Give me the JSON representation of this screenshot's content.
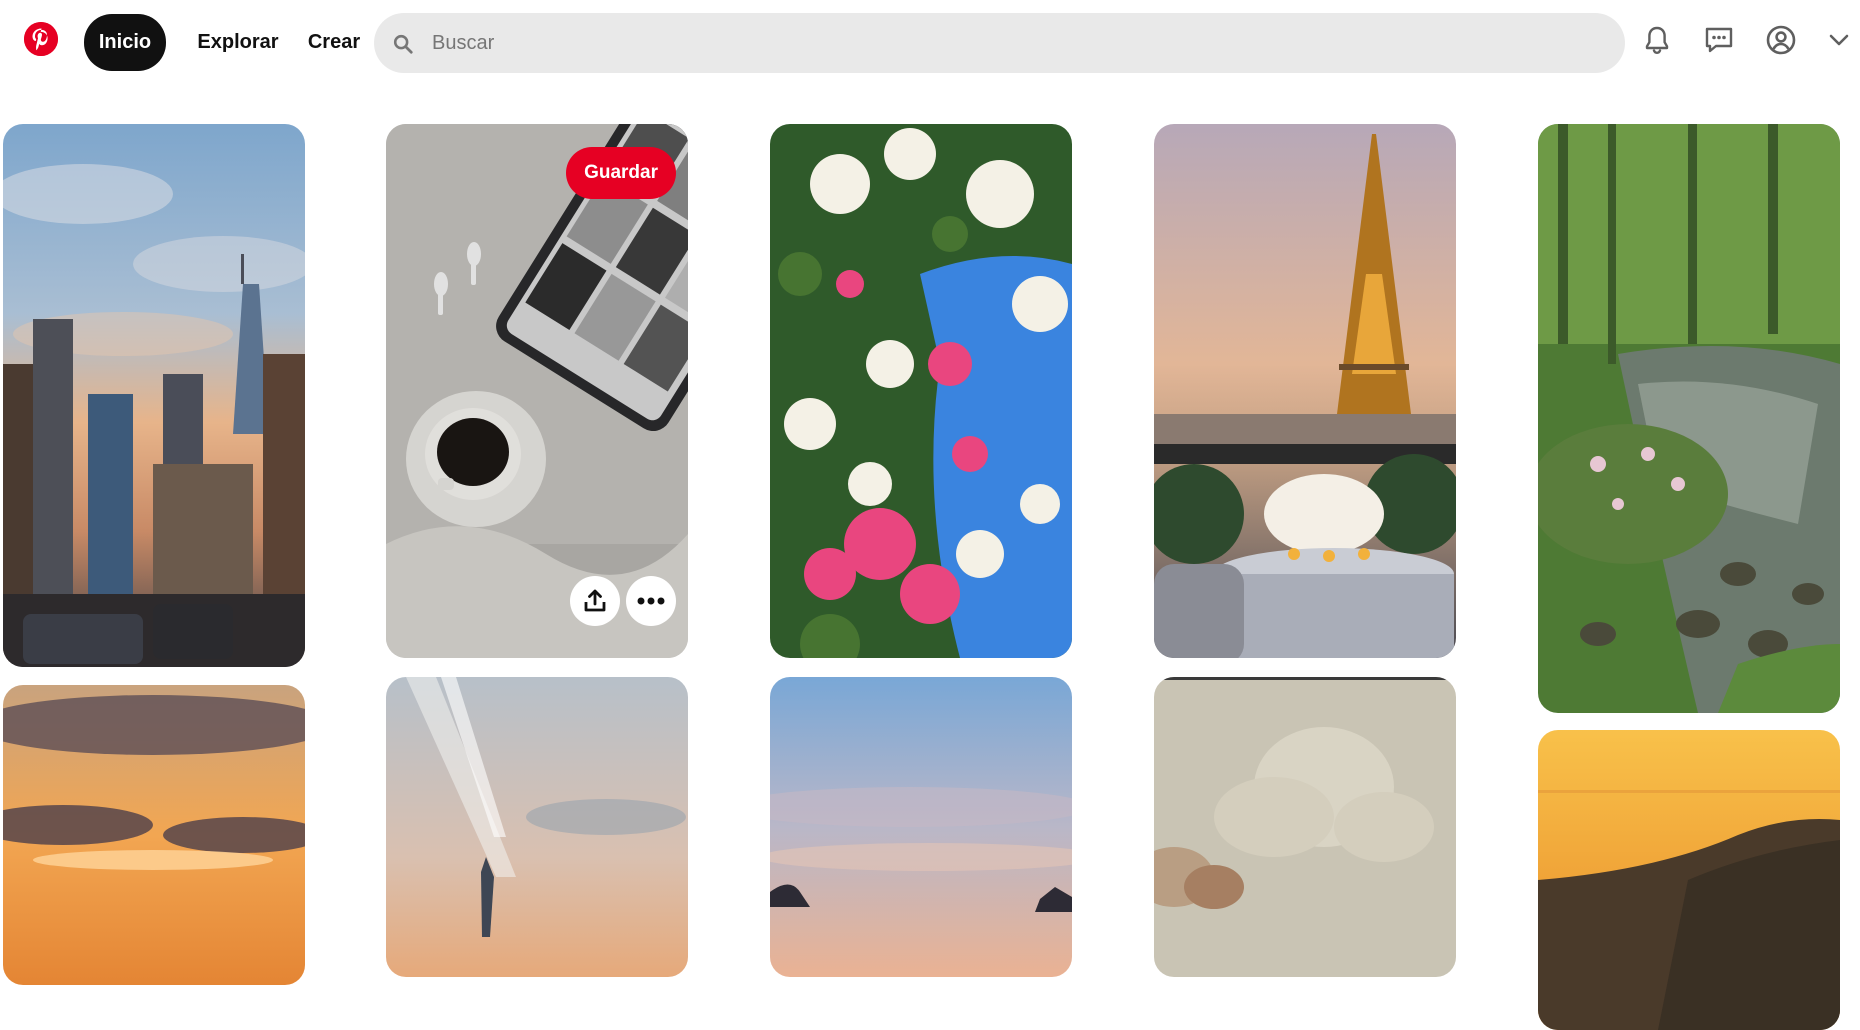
{
  "header": {
    "logo_icon": "pinterest-logo-icon",
    "nav": {
      "home": "Inicio",
      "explore": "Explorar",
      "create": "Crear"
    },
    "search": {
      "placeholder": "Buscar",
      "value": ""
    },
    "icons": [
      "notifications-bell-icon",
      "messages-icon",
      "profile-icon",
      "account-chevron-down-icon"
    ]
  },
  "pins": {
    "hovered_save_label": "Guardar",
    "items": [
      {
        "name": "pin-city-skyline",
        "palette": [
          "#8fb2d4",
          "#e6a06a",
          "#3a3d45"
        ]
      },
      {
        "name": "pin-coffee-tablet",
        "palette": [
          "#c9c7c2",
          "#6f6c68",
          "#1e1a16"
        ]
      },
      {
        "name": "pin-bougainvillea-sky",
        "palette": [
          "#3a84df",
          "#e9467f",
          "#2f5a2a"
        ]
      },
      {
        "name": "pin-eiffel-tower-dinner",
        "palette": [
          "#d5a88a",
          "#c98a3a",
          "#2e3b2e"
        ]
      },
      {
        "name": "pin-forest-stream",
        "palette": [
          "#5e8c3e",
          "#2d3a2a",
          "#9aa59a"
        ]
      },
      {
        "name": "pin-sunset-clouds",
        "palette": [
          "#f0a24a",
          "#5a4c58",
          "#2a2432"
        ]
      },
      {
        "name": "pin-sky-light-rays",
        "palette": [
          "#b9c3ce",
          "#e6b58c",
          "#3e4654"
        ]
      },
      {
        "name": "pin-evening-sky",
        "palette": [
          "#7ea9d4",
          "#e9b598",
          "#2d2b35"
        ]
      },
      {
        "name": "pin-painting-clouds",
        "palette": [
          "#c8c3b3",
          "#a7a292",
          "#8b6a4f"
        ]
      },
      {
        "name": "pin-golden-coast",
        "palette": [
          "#f6b13a",
          "#e48a2a",
          "#3a3024"
        ]
      }
    ]
  },
  "accent": "#e60023"
}
